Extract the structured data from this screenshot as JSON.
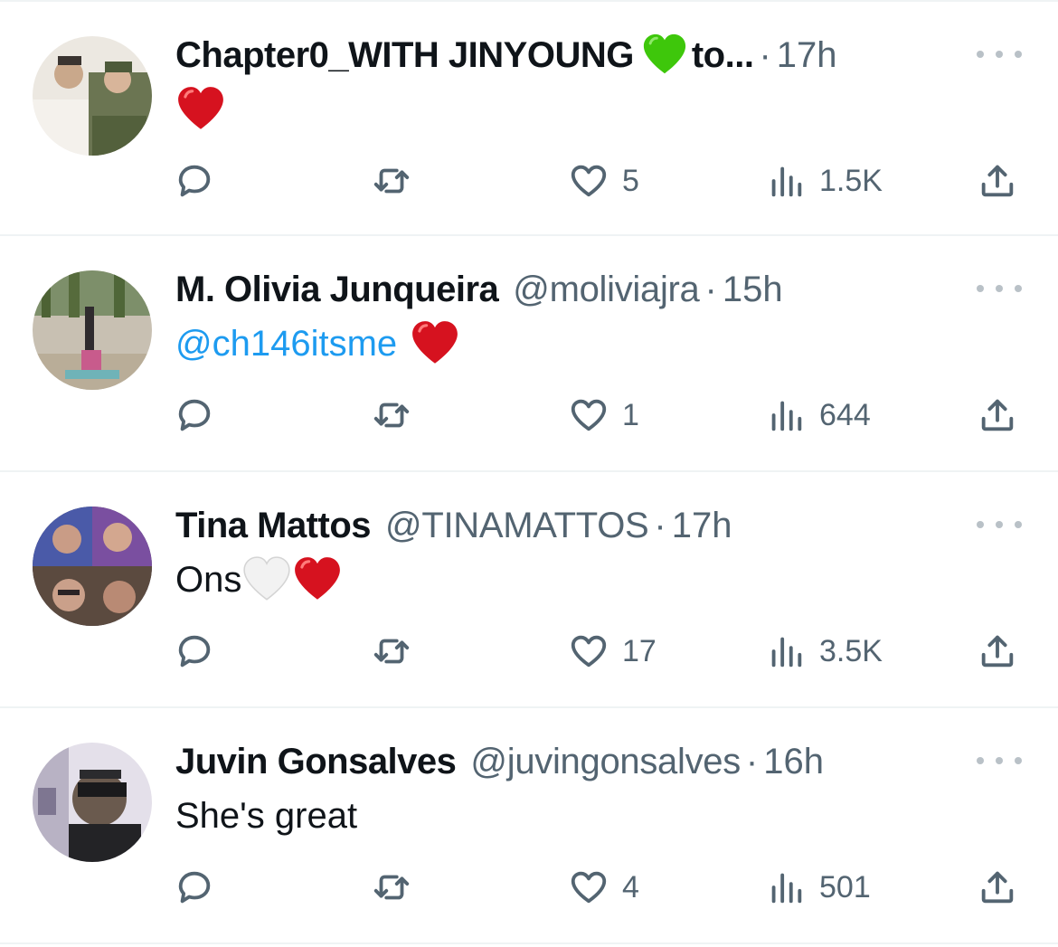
{
  "tweets": [
    {
      "name": "Chapter0_WITH JINYOUNG",
      "name_suffix": "to...",
      "handle": "",
      "time": "17h",
      "mention": "",
      "text": "",
      "likes": "5",
      "views": "1.5K",
      "avatar_colors": [
        "#e8e4dc",
        "#c9bfae",
        "#5d6b4a"
      ]
    },
    {
      "name": "M. Olivia Junqueira",
      "name_suffix": "",
      "handle": "@moliviajra",
      "time": "15h",
      "mention": "@ch146itsme",
      "text": "",
      "likes": "1",
      "views": "644",
      "avatar_colors": [
        "#d9d2c6",
        "#8a9a7c",
        "#4f6b3a"
      ]
    },
    {
      "name": "Tina Mattos",
      "name_suffix": "",
      "handle": "@TINAMATTOS",
      "time": "17h",
      "mention": "",
      "text": "Ons",
      "likes": "17",
      "views": "3.5K",
      "avatar_colors": [
        "#3b3350",
        "#a67860",
        "#6a3f8f"
      ]
    },
    {
      "name": "Juvin Gonsalves",
      "name_suffix": "",
      "handle": "@juvingonsalves",
      "time": "16h",
      "mention": "",
      "text": "She's great",
      "likes": "4",
      "views": "501",
      "avatar_colors": [
        "#e6e2ec",
        "#2a2a2e",
        "#6c6875"
      ]
    }
  ],
  "colors": {
    "text": "#0f1419",
    "secondary": "#536471",
    "link": "#1d9bf0",
    "divider": "#eff3f4",
    "heart_red": "#d6121f",
    "heart_green": "#3ec70b"
  },
  "icons": {
    "reply": "reply-icon",
    "retweet": "retweet-icon",
    "like": "like-icon",
    "views": "views-icon",
    "share": "share-icon",
    "more": "more-icon"
  },
  "separator": "·"
}
